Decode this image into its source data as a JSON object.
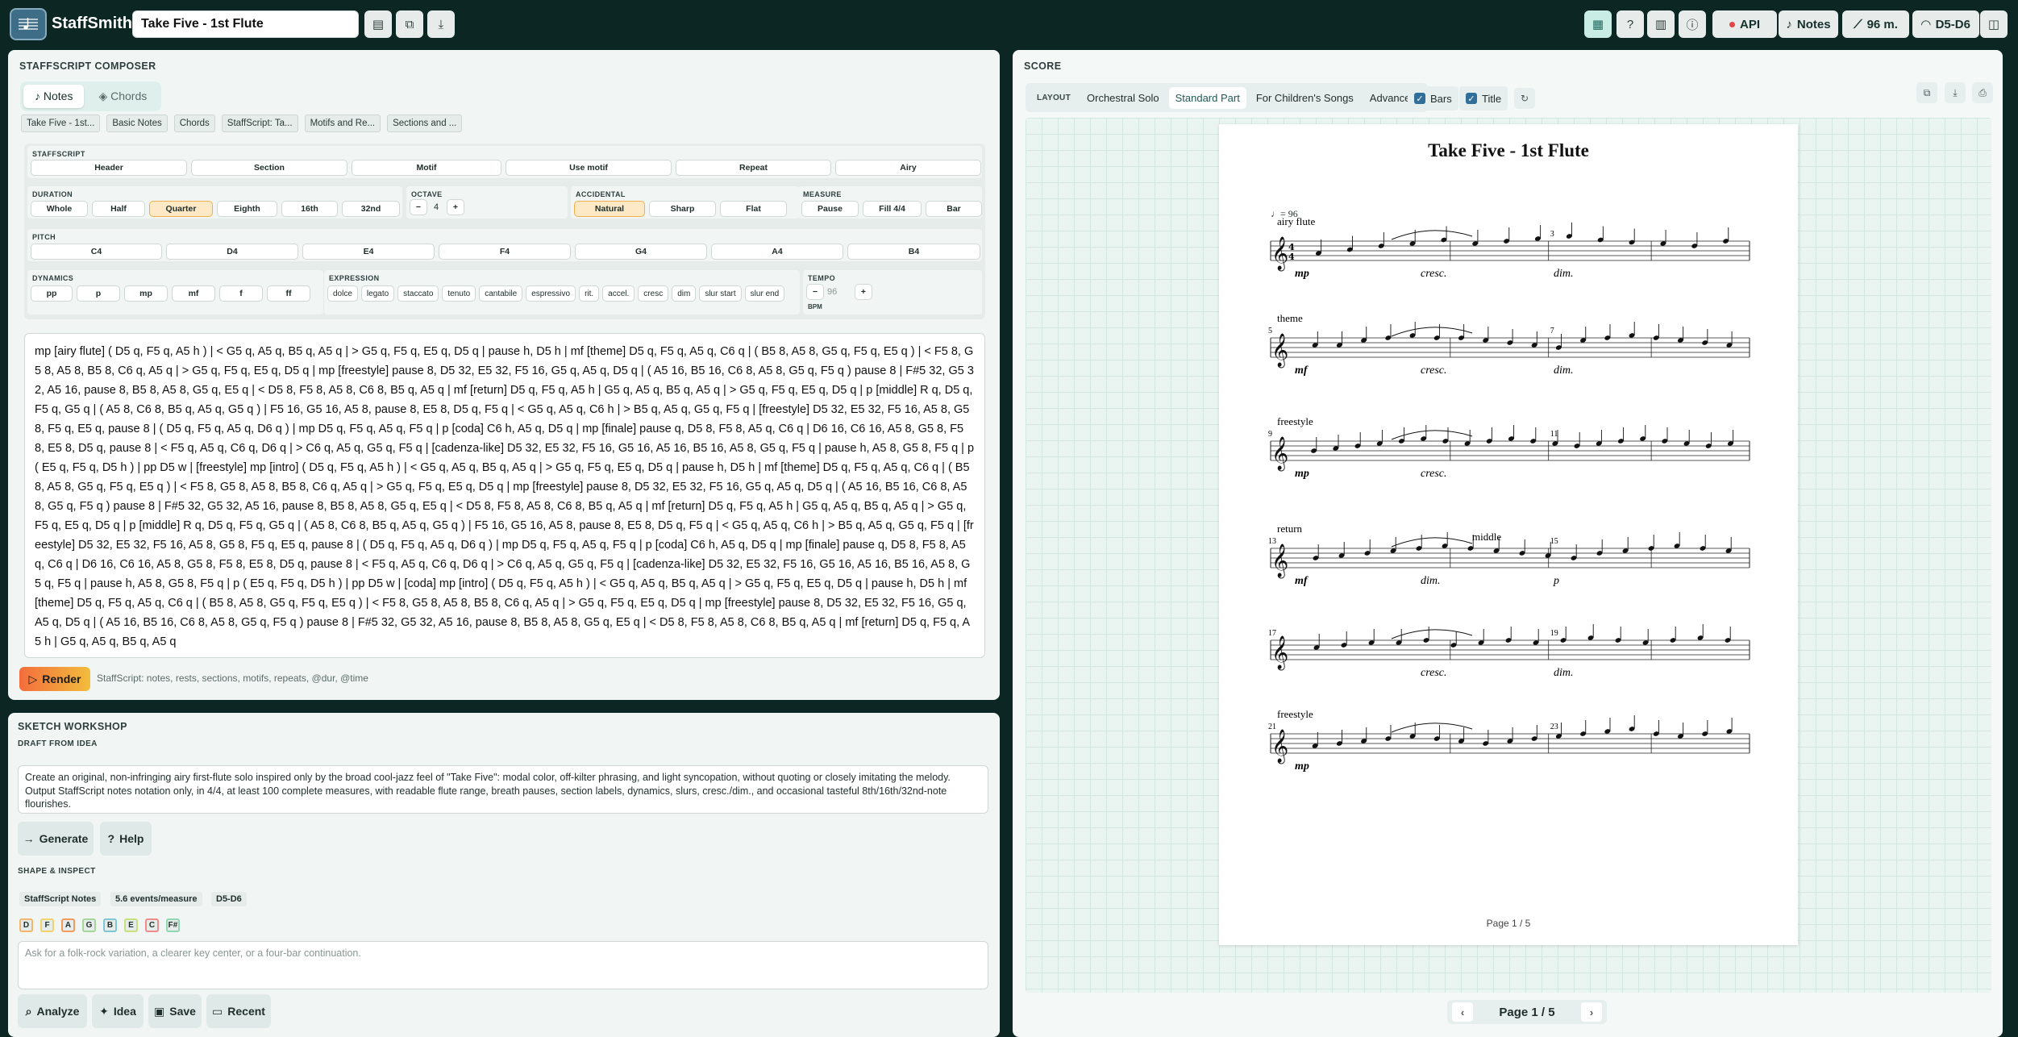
{
  "app": {
    "name": "StaffSmith",
    "document_title": "Take Five - 1st Flute"
  },
  "topbar": {
    "api_label": "API",
    "notes_label": "Notes",
    "measures_label": "96 m.",
    "range_label": "D5-D6",
    "accent_color": "#0b2623"
  },
  "composer": {
    "title": "STAFFSCRIPT COMPOSER",
    "mode_tabs": [
      "Notes",
      "Chords"
    ],
    "doc_tabs": [
      "Take Five - 1st...",
      "Basic Notes",
      "Chords",
      "StaffScript: Ta...",
      "Motifs and Re...",
      "Sections and ..."
    ],
    "staffscript": {
      "label": "STAFFSCRIPT",
      "buttons": [
        "Header",
        "Section",
        "Motif",
        "Use motif",
        "Repeat",
        "Airy"
      ]
    },
    "duration": {
      "label": "DURATION",
      "buttons": [
        "Whole",
        "Half",
        "Quarter",
        "Eighth",
        "16th",
        "32nd"
      ],
      "selected": "Quarter"
    },
    "octave": {
      "label": "OCTAVE",
      "value": "4",
      "minus": "−",
      "plus": "+"
    },
    "accidental": {
      "label": "ACCIDENTAL",
      "buttons": [
        "Natural",
        "Sharp",
        "Flat"
      ],
      "selected": "Natural"
    },
    "measure": {
      "label": "MEASURE",
      "buttons": [
        "Pause",
        "Fill 4/4",
        "Bar"
      ]
    },
    "pitch": {
      "label": "PITCH",
      "buttons": [
        "C4",
        "D4",
        "E4",
        "F4",
        "G4",
        "A4",
        "B4"
      ]
    },
    "dynamics": {
      "label": "DYNAMICS",
      "buttons": [
        "pp",
        "p",
        "mp",
        "mf",
        "f",
        "ff"
      ]
    },
    "expression": {
      "label": "EXPRESSION",
      "buttons": [
        "dolce",
        "legato",
        "staccato",
        "tenuto",
        "cantabile",
        "espressivo",
        "rit.",
        "accel.",
        "cresc",
        "dim",
        "slur start",
        "slur end"
      ]
    },
    "tempo": {
      "label": "TEMPO",
      "value": "96",
      "unit": "BPM",
      "minus": "−",
      "plus": "+"
    },
    "code": "mp [airy flute] ( D5 q, F5 q, A5 h ) | < G5 q, A5 q, B5 q, A5 q | > G5 q, F5 q, E5 q, D5 q | pause h, D5 h | mf [theme] D5 q, F5 q, A5 q, C6 q | ( B5 8, A5 8, G5 q, F5 q, E5 q ) | < F5 8, G5 8, A5 8, B5 8, C6 q, A5 q | > G5 q, F5 q, E5 q, D5 q | mp [freestyle] pause 8, D5 32, E5 32, F5 16, G5 q, A5 q, D5 q | ( A5 16, B5 16, C6 8, A5 8, G5 q, F5 q ) pause 8 | F#5 32, G5 32, A5 16, pause 8, B5 8, A5 8, G5 q, E5 q | < D5 8, F5 8, A5 8, C6 8, B5 q, A5 q | mf [return] D5 q, F5 q, A5 h | G5 q, A5 q, B5 q, A5 q | > G5 q, F5 q, E5 q, D5 q | p [middle] R q, D5 q, F5 q, G5 q | ( A5 8, C6 8, B5 q, A5 q, G5 q ) | F5 16, G5 16, A5 8, pause 8, E5 8, D5 q, F5 q | < G5 q, A5 q, C6 h | > B5 q, A5 q, G5 q, F5 q | [freestyle] D5 32, E5 32, F5 16, A5 8, G5 8, F5 q, E5 q, pause 8 | ( D5 q, F5 q, A5 q, D6 q ) | mp D5 q, F5 q, A5 q, F5 q | p [coda] C6 h, A5 q, D5 q | mp [finale] pause q, D5 8, F5 8, A5 q, C6 q | D6 16, C6 16, A5 8, G5 8, F5 8, E5 8, D5 q, pause 8 | < F5 q, A5 q, C6 q, D6 q | > C6 q, A5 q, G5 q, F5 q | [cadenza-like] D5 32, E5 32, F5 16, G5 16, A5 16, B5 16, A5 8, G5 q, F5 q | pause h, A5 8, G5 8, F5 q | p ( E5 q, F5 q, D5 h ) | pp D5 w | [freestyle] mp [intro] ( D5 q, F5 q, A5 h ) | < G5 q, A5 q, B5 q, A5 q | > G5 q, F5 q, E5 q, D5 q | pause h, D5 h | mf [theme] D5 q, F5 q, A5 q, C6 q | ( B5 8, A5 8, G5 q, F5 q, E5 q ) | < F5 8, G5 8, A5 8, B5 8, C6 q, A5 q | > G5 q, F5 q, E5 q, D5 q | mp [freestyle] pause 8, D5 32, E5 32, F5 16, G5 q, A5 q, D5 q | ( A5 16, B5 16, C6 8, A5 8, G5 q, F5 q ) pause 8 | F#5 32, G5 32, A5 16, pause 8, B5 8, A5 8, G5 q, E5 q | < D5 8, F5 8, A5 8, C6 8, B5 q, A5 q | mf [return] D5 q, F5 q, A5 h | G5 q, A5 q, B5 q, A5 q | > G5 q, F5 q, E5 q, D5 q | p [middle] R q, D5 q, F5 q, G5 q | ( A5 8, C6 8, B5 q, A5 q, G5 q ) | F5 16, G5 16, A5 8, pause 8, E5 8, D5 q, F5 q | < G5 q, A5 q, C6 h | > B5 q, A5 q, G5 q, F5 q | [freestyle] D5 32, E5 32, F5 16, A5 8, G5 8, F5 q, E5 q, pause 8 | ( D5 q, F5 q, A5 q, D6 q ) | mp D5 q, F5 q, A5 q, F5 q | p [coda] C6 h, A5 q, D5 q | mp [finale] pause q, D5 8, F5 8, A5 q, C6 q | D6 16, C6 16, A5 8, G5 8, F5 8, E5 8, D5 q, pause 8 | < F5 q, A5 q, C6 q, D6 q | > C6 q, A5 q, G5 q, F5 q | [cadenza-like] D5 32, E5 32, F5 16, G5 16, A5 16, B5 16, A5 8, G5 q, F5 q | pause h, A5 8, G5 8, F5 q | p ( E5 q, F5 q, D5 h ) | pp D5 w | [coda] mp [intro] ( D5 q, F5 q, A5 h ) | < G5 q, A5 q, B5 q, A5 q | > G5 q, F5 q, E5 q, D5 q | pause h, D5 h | mf [theme] D5 q, F5 q, A5 q, C6 q | ( B5 8, A5 8, G5 q, F5 q, E5 q ) | < F5 8, G5 8, A5 8, B5 8, C6 q, A5 q | > G5 q, F5 q, E5 q, D5 q | mp [freestyle] pause 8, D5 32, E5 32, F5 16, G5 q, A5 q, D5 q | ( A5 16, B5 16, C6 8, A5 8, G5 q, F5 q ) pause 8 | F#5 32, G5 32, A5 16, pause 8, B5 8, A5 8, G5 q, E5 q | < D5 8, F5 8, A5 8, C6 8, B5 q, A5 q | mf [return] D5 q, F5 q, A5 h | G5 q, A5 q, B5 q, A5 q",
    "render_label": "Render",
    "hint": "StaffScript: notes, rests, sections, motifs, repeats, @dur, @time"
  },
  "sketch": {
    "title": "SKETCH WORKSHOP",
    "draft_label": "DRAFT FROM IDEA",
    "draft_text": "Create an original, non-infringing airy first-flute solo inspired only by the broad cool-jazz feel of \"Take Five\": modal color, off-kilter phrasing, and light syncopation, without quoting or closely imitating the melody. Output StaffScript notes notation only, in 4/4, at least 100 complete measures, with readable flute range, breath pauses, section labels, dynamics, slurs, cresc./dim., and occasional tasteful 8th/16th/32nd-note flourishes.",
    "generate_label": "Generate",
    "help_label": "Help",
    "shape_label": "SHAPE & INSPECT",
    "chips": [
      "StaffScript Notes",
      "5.6 events/measure",
      "D5-D6"
    ],
    "note_chips": [
      {
        "name": "D",
        "color": "#f3b66b"
      },
      {
        "name": "F",
        "color": "#f0d36a"
      },
      {
        "name": "A",
        "color": "#f39a5c"
      },
      {
        "name": "G",
        "color": "#a6d79a"
      },
      {
        "name": "B",
        "color": "#7fc6d6"
      },
      {
        "name": "E",
        "color": "#c9e07d"
      },
      {
        "name": "C",
        "color": "#f08b8b"
      },
      {
        "name": "F#",
        "color": "#8fd6b2"
      }
    ],
    "ask_placeholder": "Ask for a folk-rock variation, a clearer key center, or a four-bar continuation.",
    "analyze_label": "Analyze",
    "idea_label": "Idea",
    "save_label": "Save",
    "recent_label": "Recent"
  },
  "score": {
    "title": "SCORE",
    "layout_label": "LAYOUT",
    "layout_tabs": [
      "Orchestral Solo",
      "Standard Part",
      "For Children's Songs",
      "Advanced"
    ],
    "layout_selected": "Standard Part",
    "bars_label": "Bars",
    "title_label": "Title",
    "bars_checked": true,
    "title_checked": true,
    "sheet_title": "Take Five - 1st Flute",
    "tempo_mark": "♩= 96",
    "systems": [
      {
        "start_measure": "",
        "mid_measure": "3",
        "label": "airy flute",
        "dynamics": "mp",
        "hairpin1": "cresc.",
        "hairpin2": "dim.",
        "extra": ""
      },
      {
        "start_measure": "5",
        "mid_measure": "7",
        "label": "theme",
        "dynamics": "mf",
        "hairpin1": "cresc.",
        "hairpin2": "dim.",
        "extra": ""
      },
      {
        "start_measure": "9",
        "mid_measure": "11",
        "label": "freestyle",
        "dynamics": "mp",
        "hairpin1": "cresc.",
        "hairpin2": "",
        "extra": ""
      },
      {
        "start_measure": "13",
        "mid_measure": "15",
        "label": "return",
        "dynamics": "mf",
        "hairpin1": "dim.",
        "hairpin2": "p",
        "extra": "middle"
      },
      {
        "start_measure": "17",
        "mid_measure": "19",
        "label": "",
        "dynamics": "",
        "hairpin1": "cresc.",
        "hairpin2": "dim.",
        "extra": ""
      },
      {
        "start_measure": "21",
        "mid_measure": "23",
        "label": "freestyle",
        "dynamics": "mp",
        "hairpin1": "",
        "hairpin2": "",
        "extra": ""
      }
    ],
    "page_footer": "Page 1 / 5",
    "pager_label": "Page 1 / 5"
  }
}
